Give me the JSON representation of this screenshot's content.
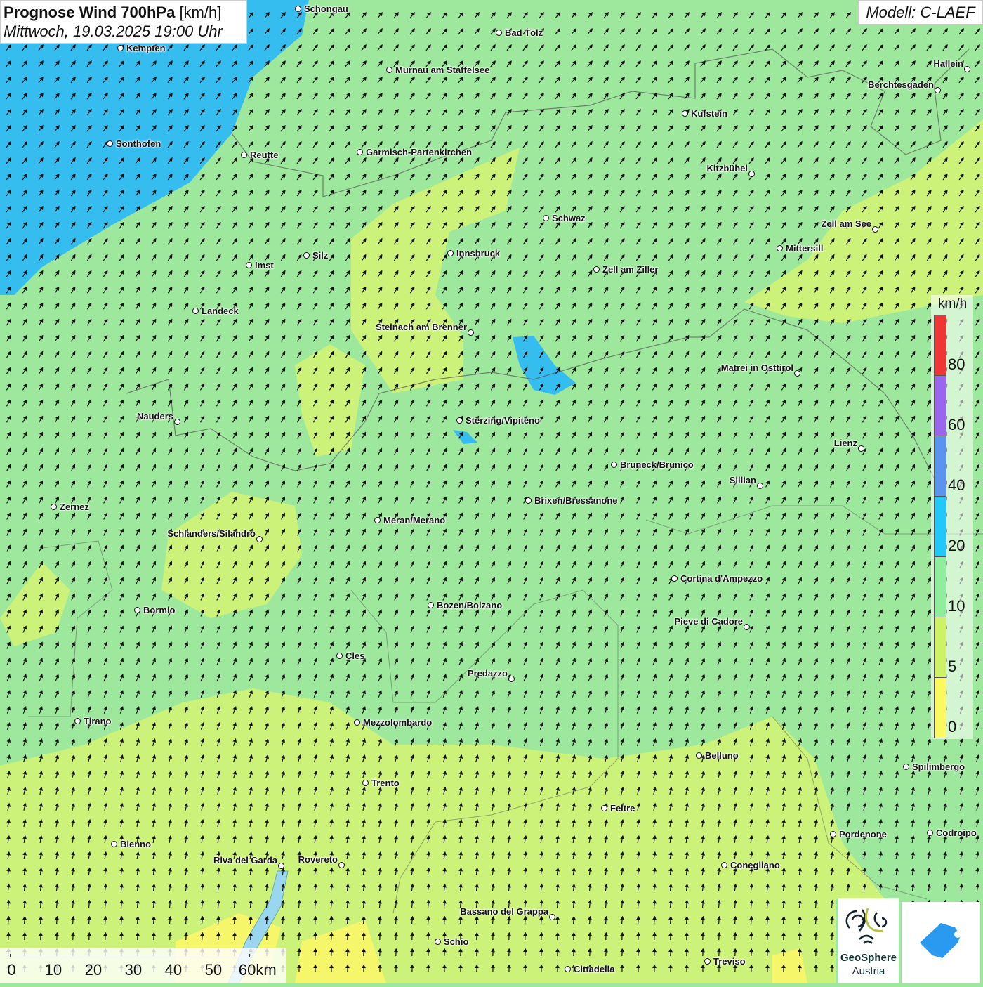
{
  "header": {
    "title_bold": "Prognose Wind 700hPa",
    "title_unit": "[km/h]",
    "datetime": "Mittwoch, 19.03.2025 19:00 Uhr"
  },
  "model": "Modell: C-LAEF",
  "legend": {
    "unit": "km/h",
    "bins": [
      {
        "label": "80",
        "color": "#f03535"
      },
      {
        "label": "60",
        "color": "#9b66ee"
      },
      {
        "label": "40",
        "color": "#5a94ee"
      },
      {
        "label": "20",
        "color": "#22c8fa"
      },
      {
        "label": "10",
        "color": "#8eee9e"
      },
      {
        "label": "5",
        "color": "#cdf266"
      },
      {
        "label": "0",
        "color": "#fcf860"
      }
    ]
  },
  "scale_bar": {
    "ticks": [
      "0",
      "10",
      "20",
      "30",
      "40",
      "50",
      "60km"
    ]
  },
  "logos": {
    "geosphere_line1": "GeoSphere",
    "geosphere_line2": "Austria"
  },
  "cities": [
    "Schongau",
    "Bad Tölz",
    "Kempten",
    "Murnau am Staffelsee",
    "Hallein",
    "Berchtesgaden",
    "Kufstein",
    "Sonthofen",
    "Reutte",
    "Garmisch-Partenkirchen",
    "Kitzbühel",
    "Schwaz",
    "Zell am See",
    "Innsbruck",
    "Mittersill",
    "Silz",
    "Imst",
    "Zell am Ziller",
    "Landeck",
    "Steinach am Brenner",
    "Matrei in Osttirol",
    "Nauders",
    "Sterzing/Vipiteno",
    "Lienz",
    "Bruneck/Brunico",
    "Sillian",
    "Zernez",
    "Brixen/Bressanone",
    "Meran/Merano",
    "Schlanders/Silandro",
    "Cortina d'Ampezzo",
    "Bozen/Bolzano",
    "Bormio",
    "Pieve di Cadore",
    "Cles",
    "Predazzo",
    "Tirano",
    "Mezzolombardo",
    "Belluno",
    "Spilimbergo",
    "Trento",
    "Feltre",
    "Pordenone",
    "Codroipo",
    "Bienno",
    "Riva del Garda",
    "Rovereto",
    "Conegliano",
    "Bassano del Grappa",
    "Schio",
    "Cittadella",
    "Treviso"
  ]
}
